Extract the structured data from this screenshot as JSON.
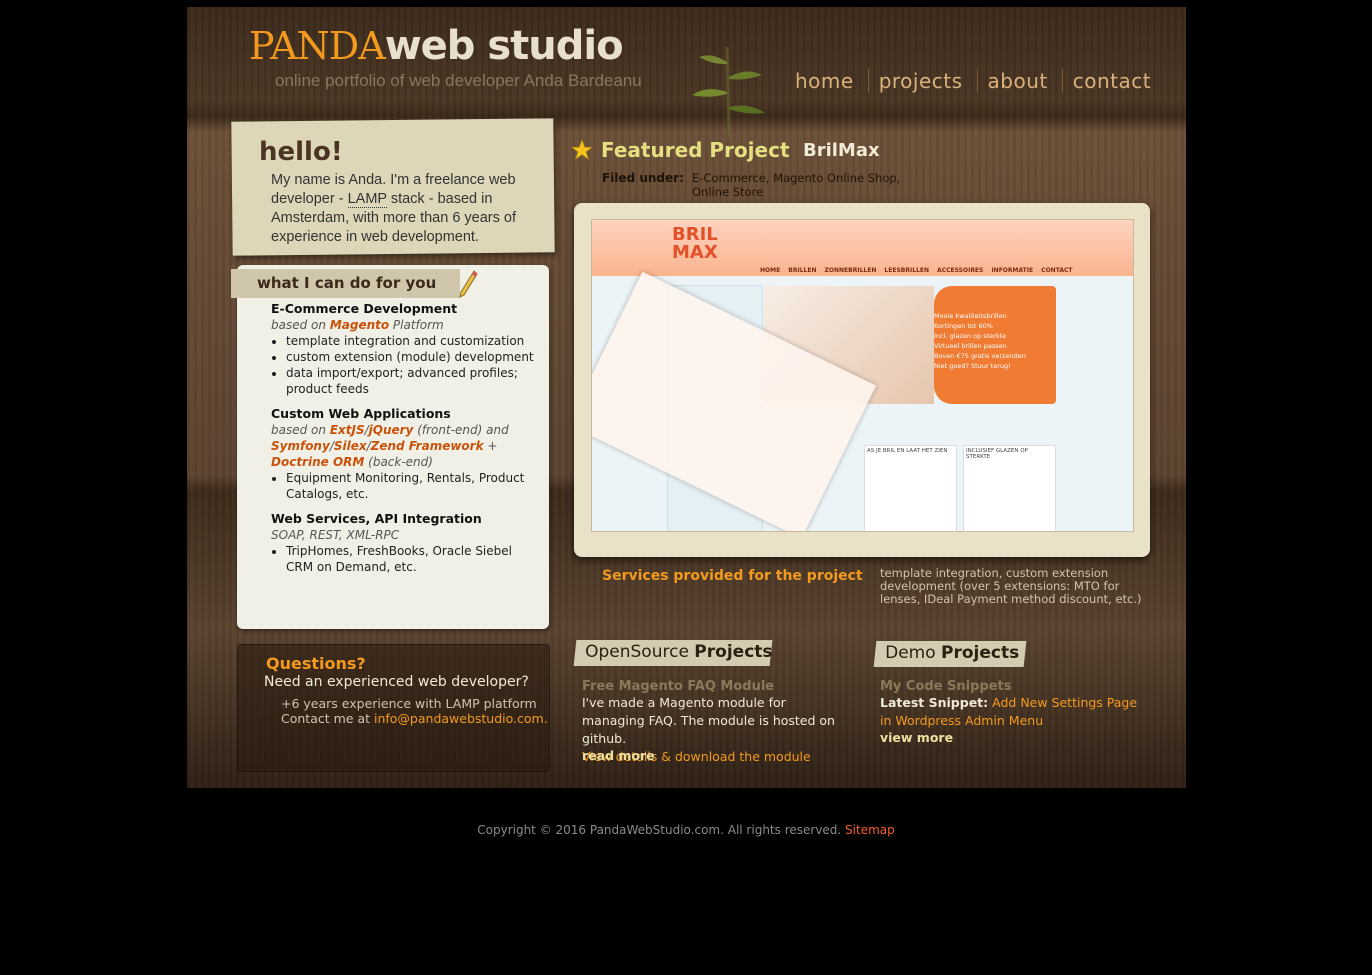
{
  "header": {
    "logo_part1": "PANDA",
    "logo_part2": "web studio",
    "tagline": "online portfolio of web developer Anda Bardeanu",
    "nav": [
      "home",
      "projects",
      "about",
      "contact"
    ]
  },
  "intro": {
    "title": "hello!",
    "text_before": "My name is Anda. I'm a freelance web developer - ",
    "abbr": "LAMP",
    "text_after": " stack - based in Amsterdam, with more than 6 years of experience in web development."
  },
  "services": {
    "heading": "what I can do for you",
    "items": [
      {
        "title": "E-Commerce Development",
        "based_prefix": "based on ",
        "based_tech": "Magento",
        "based_suffix": " Platform",
        "bullets": [
          "template integration and customization",
          "custom extension (module) development",
          "data import/export; advanced profiles; product feeds"
        ]
      },
      {
        "title": "Custom Web Applications",
        "based_prefix": "based on ",
        "tech1": "ExtJS",
        "sep1": "/",
        "tech2": "jQuery",
        "mid": " (front-end) and ",
        "tech3": "Symfony",
        "sep2": "/",
        "tech4": "Silex",
        "sep3": "/",
        "tech5": "Zend Framework",
        "plus": " + ",
        "tech6": "Doctrine ORM",
        "end": " (back-end)",
        "bullets": [
          "Equipment Monitoring, Rentals, Product Catalogs, etc."
        ]
      },
      {
        "title": "Web Services, API Integration",
        "based": "SOAP, REST, XML-RPC",
        "bullets": [
          "TripHomes, FreshBooks, Oracle Siebel CRM on Demand, etc."
        ]
      }
    ]
  },
  "featured": {
    "title": "Featured Project",
    "name": "BrilMax",
    "filed_label": "Filed under:",
    "filed_value": "E-Commerce, Magento Online Shop, Online Store",
    "shot": {
      "brand_line1": "BRIL",
      "brand_line2": "MAX",
      "menu": "HOME BRILLEN ZONNEBRILLEN LEESBRILLEN ACCESSOIRES INFORMATIE CONTACT",
      "promo": [
        "Mooie kwaliteitsbrillen",
        "Kortingen tot 60%",
        "Incl. glazen op sterkte",
        "Virtueel brillen passen",
        "Boven €75 gratis verzenden",
        "Niet goed? Stuur terug!"
      ],
      "col1": "AS JE BRIL EN LAAT HET ZIEN",
      "col2": "INCLUSIEF GLAZEN OP STERKTE"
    },
    "services_label": "Services provided for the project",
    "services_text": "template integration, custom extension development (over 5 extensions: MTO for lenses, IDeal Payment method discount, etc.)"
  },
  "questions": {
    "title": "Questions?",
    "subtitle": "Need an experienced web developer?",
    "line1": "+6 years experience with LAMP platform",
    "line2_prefix": "Contact me at ",
    "email": "info@pandawebstudio.com."
  },
  "opensource": {
    "heading_light": "OpenSource ",
    "heading_bold": "Projects",
    "item_title": "Free Magento FAQ Module",
    "text": "I've made a Magento module for managing FAQ. The module is hosted on github.",
    "link": "View details & download the module",
    "more": "read more"
  },
  "demo": {
    "heading_light": "Demo ",
    "heading_bold": "Projects",
    "item_title": "My Code Snippets",
    "latest_label": "Latest Snippet:",
    "latest_link": "Add New Settings Page in Wordpress Admin Menu",
    "more": "view more"
  },
  "footer": {
    "text": "Copyright © 2016 PandaWebStudio.com. All rights reserved. ",
    "link": "Sitemap"
  }
}
